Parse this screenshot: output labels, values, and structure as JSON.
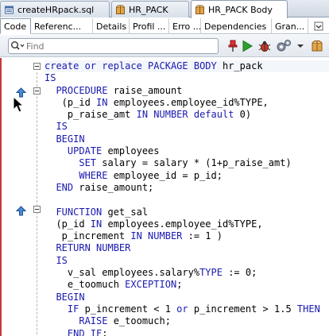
{
  "doc_tabs": [
    {
      "label": "createHRpack.sql",
      "icon": "sql-file-icon"
    },
    {
      "label": "HR_PACK",
      "icon": "package-icon"
    },
    {
      "label": "HR_PACK Body",
      "icon": "package-body-icon"
    }
  ],
  "sub_tabs": [
    {
      "label": "Code"
    },
    {
      "label": "Referenc..."
    },
    {
      "label": "Details"
    },
    {
      "label": "Profil ..."
    },
    {
      "label": "Erro ..."
    },
    {
      "label": "Dependencies"
    },
    {
      "label": "Gran..."
    }
  ],
  "toolbar": {
    "find_placeholder": "Find",
    "icons": [
      "pin-icon",
      "run-icon",
      "debug-icon",
      "settings-gear-icon",
      "dropdown-arrow-icon",
      "package-icon"
    ]
  },
  "colors": {
    "keyword": "#1a1ab0",
    "editor_border": "#c33a3a"
  },
  "code_lines": [
    [
      {
        "t": "create or replace PACKAGE BODY ",
        "k": 1
      },
      {
        "t": "hr_pack",
        "k": 0
      }
    ],
    [
      {
        "t": "IS",
        "k": 1
      }
    ],
    [
      {
        "t": "  PROCEDURE ",
        "k": 1
      },
      {
        "t": "raise_amount",
        "k": 0
      }
    ],
    [
      {
        "t": "   (p_id ",
        "k": 0
      },
      {
        "t": "IN ",
        "k": 1
      },
      {
        "t": "employees.employee_id%TYPE,",
        "k": 0
      }
    ],
    [
      {
        "t": "    p_raise_amt ",
        "k": 0
      },
      {
        "t": "IN NUMBER default ",
        "k": 1
      },
      {
        "t": "0)",
        "k": 0
      }
    ],
    [
      {
        "t": "  IS",
        "k": 1
      }
    ],
    [
      {
        "t": "  BEGIN",
        "k": 1
      }
    ],
    [
      {
        "t": "    UPDATE ",
        "k": 1
      },
      {
        "t": "employees",
        "k": 0
      }
    ],
    [
      {
        "t": "      SET ",
        "k": 1
      },
      {
        "t": "salary = salary * (1+p_raise_amt)",
        "k": 0
      }
    ],
    [
      {
        "t": "      WHERE ",
        "k": 1
      },
      {
        "t": "employee_id = p_id;",
        "k": 0
      }
    ],
    [
      {
        "t": "  END ",
        "k": 1
      },
      {
        "t": "raise_amount;",
        "k": 0
      }
    ],
    [
      {
        "t": "",
        "k": 0
      }
    ],
    [
      {
        "t": "  FUNCTION ",
        "k": 1
      },
      {
        "t": "get_sal",
        "k": 0
      }
    ],
    [
      {
        "t": "  (p_id ",
        "k": 0
      },
      {
        "t": "IN ",
        "k": 1
      },
      {
        "t": "employees.employee_id%TYPE,",
        "k": 0
      }
    ],
    [
      {
        "t": "   p_increment ",
        "k": 0
      },
      {
        "t": "IN NUMBER ",
        "k": 1
      },
      {
        "t": ":= 1 )",
        "k": 0
      }
    ],
    [
      {
        "t": "  RETURN NUMBER",
        "k": 1
      }
    ],
    [
      {
        "t": "  IS",
        "k": 1
      }
    ],
    [
      {
        "t": "    v_sal employees.salary%",
        "k": 0
      },
      {
        "t": "TYPE ",
        "k": 1
      },
      {
        "t": ":= 0;",
        "k": 0
      }
    ],
    [
      {
        "t": "    e_toomuch ",
        "k": 0
      },
      {
        "t": "EXCEPTION",
        "k": 1
      },
      {
        "t": ";",
        "k": 0
      }
    ],
    [
      {
        "t": "  BEGIN",
        "k": 1
      }
    ],
    [
      {
        "t": "    IF ",
        "k": 1
      },
      {
        "t": "p_increment < 1 ",
        "k": 0
      },
      {
        "t": "or ",
        "k": 1
      },
      {
        "t": "p_increment > 1.5 ",
        "k": 0
      },
      {
        "t": "THEN",
        "k": 1
      }
    ],
    [
      {
        "t": "      RAISE ",
        "k": 1
      },
      {
        "t": "e_toomuch;",
        "k": 0
      }
    ],
    [
      {
        "t": "    END IF",
        "k": 1
      },
      {
        "t": ";",
        "k": 0
      }
    ]
  ]
}
